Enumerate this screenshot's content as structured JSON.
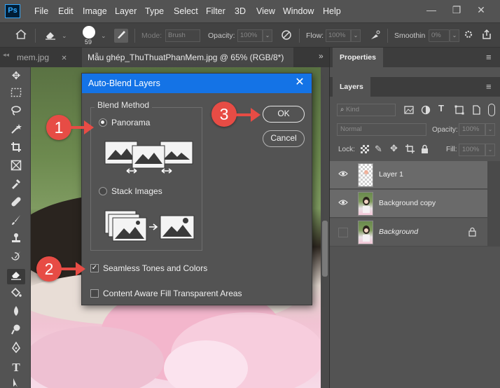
{
  "app": {
    "logo": "Ps"
  },
  "menubar": {
    "items": [
      "File",
      "Edit",
      "Image",
      "Layer",
      "Type",
      "Select",
      "Filter",
      "3D",
      "View",
      "Window",
      "Help"
    ],
    "window_controls": {
      "minimize": "—",
      "restore": "❐",
      "close": "✕"
    }
  },
  "options_bar": {
    "mode_label": "Mode:",
    "mode_value": "Brush",
    "opacity_label": "Opacity:",
    "opacity_value": "100%",
    "flow_label": "Flow:",
    "flow_value": "100%",
    "smoothing_label": "Smoothin",
    "smoothing_value": "0%",
    "brush_size": "59"
  },
  "doc_tabs": {
    "inactive_label": "mem.jpg",
    "inactive_close": "✕",
    "active_label": "Mẫu ghép_ThuThuatPhanMem.jpg @ 65% (RGB/8*) *",
    "active_close": "✕",
    "overflow": "»"
  },
  "properties_panel": {
    "title": "Properties"
  },
  "layers_panel": {
    "title": "Layers",
    "kind_placeholder": "Kind",
    "blend_mode": "Normal",
    "opacity_label": "Opacity:",
    "opacity_value": "100%",
    "lock_label": "Lock:",
    "fill_label": "Fill:",
    "fill_value": "100%",
    "layers": [
      {
        "name": "Layer 1",
        "visible": true
      },
      {
        "name": "Background copy",
        "visible": true
      },
      {
        "name": "Background",
        "visible": false
      }
    ]
  },
  "dialog": {
    "title": "Auto-Blend Layers",
    "close": "✕",
    "blend_method_label": "Blend Method",
    "option_panorama": "Panorama",
    "option_stack": "Stack Images",
    "selected_method": "Panorama",
    "seamless_label": "Seamless Tones and Colors",
    "seamless_checked": true,
    "content_aware_label": "Content Aware Fill Transparent Areas",
    "content_aware_checked": false,
    "ok_label": "OK",
    "cancel_label": "Cancel"
  },
  "annotations": [
    {
      "number": "1"
    },
    {
      "number": "2"
    },
    {
      "number": "3"
    }
  ],
  "colors": {
    "accent": "#1473e6",
    "marker": "#e74c45",
    "panel": "#535353"
  }
}
